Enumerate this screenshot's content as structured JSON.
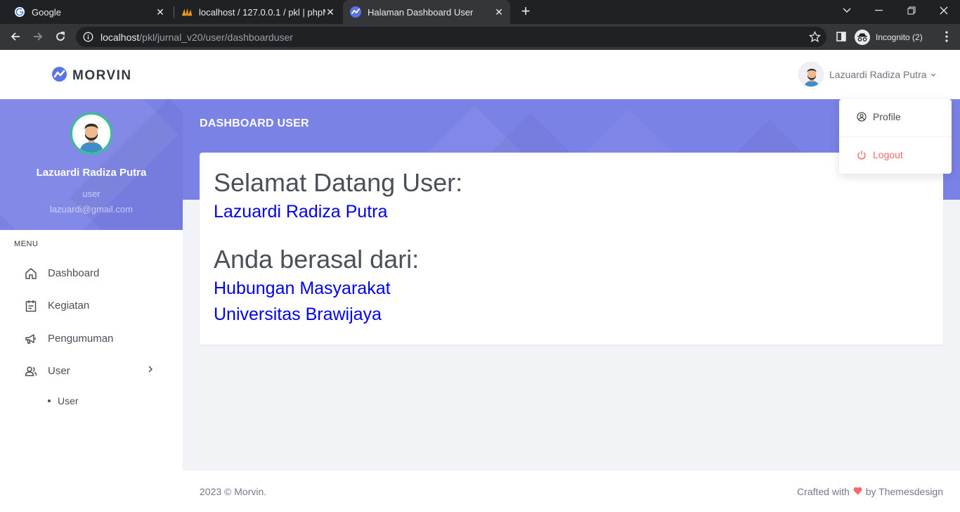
{
  "browser": {
    "tabs": [
      {
        "title": "Google",
        "icon": "google-icon"
      },
      {
        "title": "localhost / 127.0.0.1 / pkl | phpMyAdmin",
        "icon": "phpmyadmin-icon"
      },
      {
        "title": "Halaman Dashboard User",
        "icon": "morvin-icon"
      }
    ],
    "new_tab": "+",
    "url_host": "localhost",
    "url_path": "/pkl/jurnal_v20/user/dashboarduser",
    "incognito_label": "Incognito (2)"
  },
  "app": {
    "logo_text": "MORVIN",
    "accent": "#7b82e6",
    "user_name": "Lazuardi Radiza Putra",
    "dropdown": {
      "profile": "Profile",
      "logout": "Logout"
    }
  },
  "sidebar": {
    "name": "Lazuardi Radiza Putra",
    "role": "user",
    "email": "lazuardi@gmail.com",
    "menu_title": "MENU",
    "items": [
      {
        "label": "Dashboard",
        "icon": "home-icon"
      },
      {
        "label": "Kegiatan",
        "icon": "calendar-icon"
      },
      {
        "label": "Pengumuman",
        "icon": "megaphone-icon"
      },
      {
        "label": "User",
        "icon": "users-icon"
      }
    ],
    "subitems": [
      {
        "label": "User"
      }
    ]
  },
  "main": {
    "page_title": "DASHBOARD USER",
    "welcome_heading": "Selamat Datang User:",
    "user_name": "Lazuardi Radiza Putra",
    "origin_heading": "Anda berasal dari:",
    "department": "Hubungan Masyarakat",
    "university": "Universitas Brawijaya"
  },
  "footer": {
    "left": "2023 © Morvin.",
    "right_prefix": "Crafted with",
    "right_suffix": "by Themesdesign"
  }
}
